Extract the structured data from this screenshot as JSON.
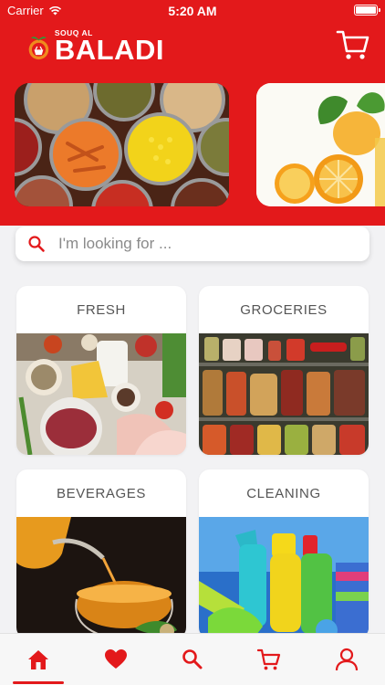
{
  "status_bar": {
    "carrier": "Carrier",
    "time": "5:20 AM"
  },
  "brand": {
    "line1": "SOUQ AL",
    "line2": "BALADI",
    "color": "#e3191b"
  },
  "banners": [
    {
      "name": "canned-goods-banner"
    },
    {
      "name": "citrus-fruits-banner"
    }
  ],
  "search": {
    "placeholder": "I'm looking for ..."
  },
  "categories": [
    {
      "label": "FRESH"
    },
    {
      "label": "GROCERIES"
    },
    {
      "label": "BEVERAGES"
    },
    {
      "label": "CLEANING"
    }
  ],
  "tabs": [
    {
      "icon": "home-icon",
      "active": true
    },
    {
      "icon": "heart-icon",
      "active": false
    },
    {
      "icon": "search-icon",
      "active": false
    },
    {
      "icon": "cart-icon",
      "active": false
    },
    {
      "icon": "profile-icon",
      "active": false
    }
  ]
}
